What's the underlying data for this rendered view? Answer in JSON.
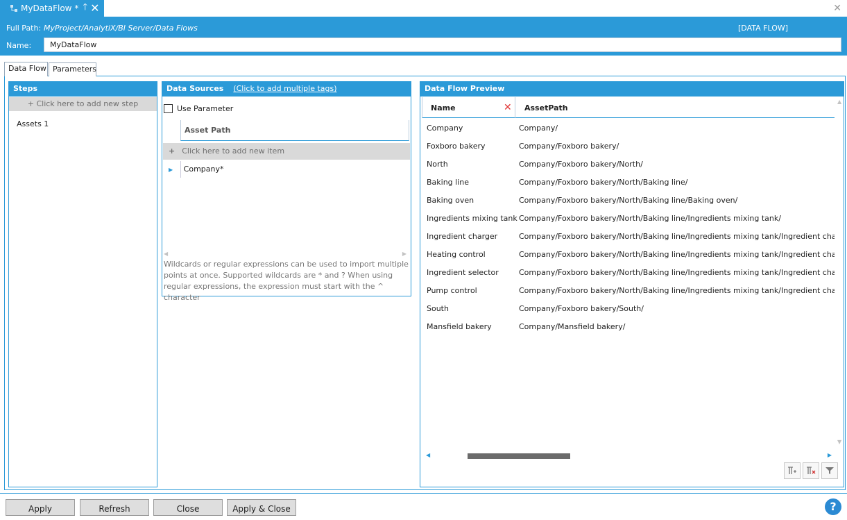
{
  "document_tab": {
    "title": "MyDataFlow *",
    "pin_icon": "pin-icon",
    "close_icon": "close-icon"
  },
  "window": {
    "close_icon": "close-icon"
  },
  "header": {
    "full_path_label": "Full Path:",
    "full_path_value": "MyProject/AnalytiX/BI Server/Data Flows",
    "type_label": "[DATA FLOW]",
    "name_label": "Name:",
    "name_value": "MyDataFlow"
  },
  "tabs": [
    {
      "label": "Data Flow",
      "active": true
    },
    {
      "label": "Parameters",
      "active": false
    }
  ],
  "steps_panel": {
    "title": "Steps",
    "add_step": "+  Click here to add new step",
    "items": [
      {
        "label": "Assets  1"
      }
    ]
  },
  "sources_panel": {
    "title": "Data Sources",
    "link": "(Click to add multiple tags)",
    "use_parameter": "Use Parameter",
    "use_parameter_checked": false,
    "column_header": "Asset Path",
    "add_item": "Click here to add new item",
    "rows": [
      {
        "value": "Company*"
      }
    ],
    "hint": "Wildcards or regular expressions can be used to import multiple points at once. Supported wildcards are * and ? When using regular expressions, the expression must start with the ^ character"
  },
  "preview_panel": {
    "title": "Data Flow Preview",
    "columns": [
      "Name",
      "AssetPath"
    ],
    "rows": [
      {
        "name": "Company",
        "path": "Company/"
      },
      {
        "name": "Foxboro bakery",
        "path": "Company/Foxboro bakery/"
      },
      {
        "name": "North",
        "path": "Company/Foxboro bakery/North/"
      },
      {
        "name": "Baking line",
        "path": "Company/Foxboro bakery/North/Baking line/"
      },
      {
        "name": "Baking oven",
        "path": "Company/Foxboro bakery/North/Baking line/Baking oven/"
      },
      {
        "name": "Ingredients mixing tank",
        "path": "Company/Foxboro bakery/North/Baking line/Ingredients mixing tank/"
      },
      {
        "name": "Ingredient charger",
        "path": "Company/Foxboro bakery/North/Baking line/Ingredients mixing tank/Ingredient charg"
      },
      {
        "name": "Heating control",
        "path": "Company/Foxboro bakery/North/Baking line/Ingredients mixing tank/Ingredient charg"
      },
      {
        "name": "Ingredient selector",
        "path": "Company/Foxboro bakery/North/Baking line/Ingredients mixing tank/Ingredient charg"
      },
      {
        "name": "Pump control",
        "path": "Company/Foxboro bakery/North/Baking line/Ingredients mixing tank/Ingredient charg"
      },
      {
        "name": "South",
        "path": "Company/Foxboro bakery/South/"
      },
      {
        "name": "Mansfield bakery",
        "path": "Company/Mansfield bakery/"
      }
    ],
    "tool_icons": [
      "filter-add-icon",
      "filter-remove-icon",
      "filter-icon"
    ]
  },
  "footer": {
    "buttons": [
      "Apply",
      "Refresh",
      "Close",
      "Apply & Close"
    ],
    "help_icon": "help-icon"
  },
  "colors": {
    "accent": "#2b9ad8",
    "button_bg": "#dedede",
    "gray_row": "#d9d9d9"
  }
}
